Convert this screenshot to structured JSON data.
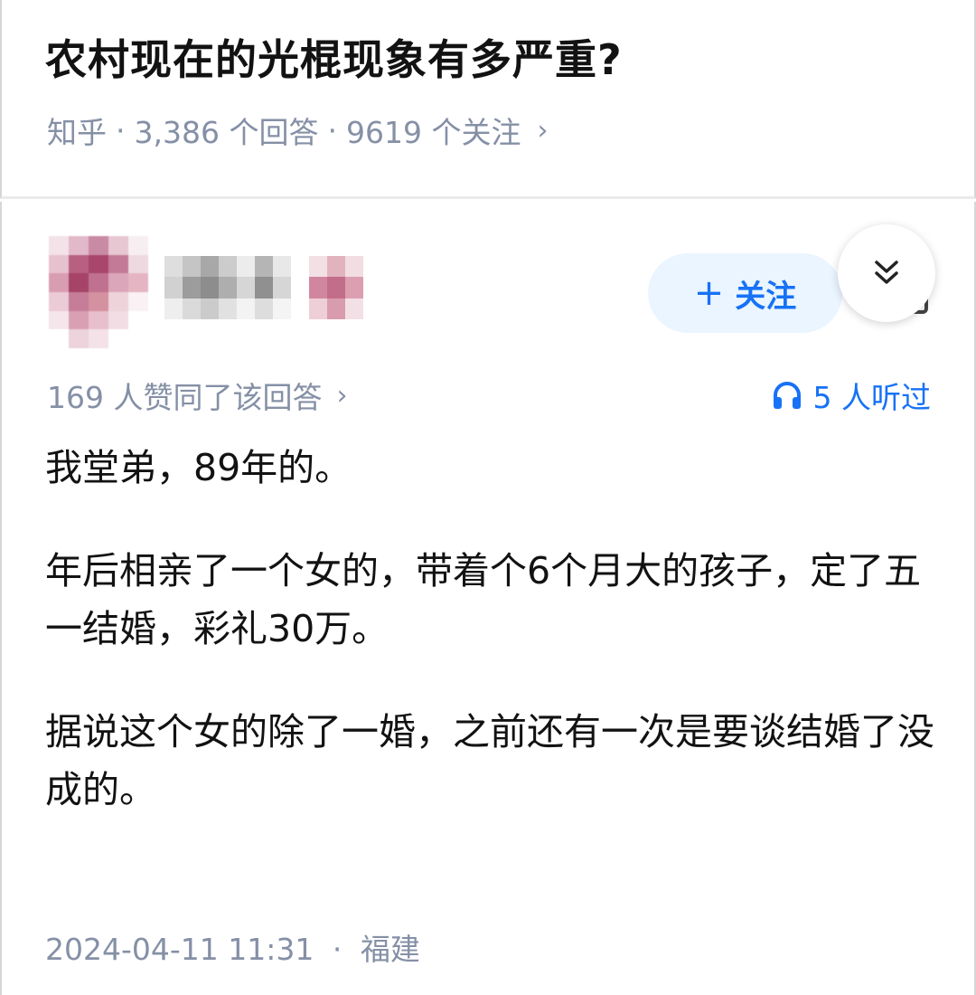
{
  "question": {
    "title": "农村现在的光棍现象有多严重?",
    "source": "知乎",
    "separator": "·",
    "answers_count": "3,386 个回答",
    "followers_count": "9619 个关注",
    "chevron": "›"
  },
  "answer": {
    "follow_button_label": "关注",
    "follow_plus": "+",
    "collapse_icon": "chevron-double-down-icon",
    "vote_text": "169 人赞同了该回答",
    "vote_chevron": "›",
    "listen_text": "5 人听过",
    "listen_icon": "headphones-icon",
    "paragraphs": [
      "我堂弟，89年的。",
      "年后相亲了一个女的，带着个6个月大的孩子，定了五一结婚，彩礼30万。",
      "据说这个女的除了一婚，之前还有一次是要谈结婚了没成的。"
    ],
    "date": "2024-04-11 11:31",
    "dot": "·",
    "location": "福建"
  },
  "colors": {
    "accent": "#1772f6",
    "accent_bg": "#ebf5ff",
    "meta_gray": "#8590a6",
    "text": "#121212"
  }
}
